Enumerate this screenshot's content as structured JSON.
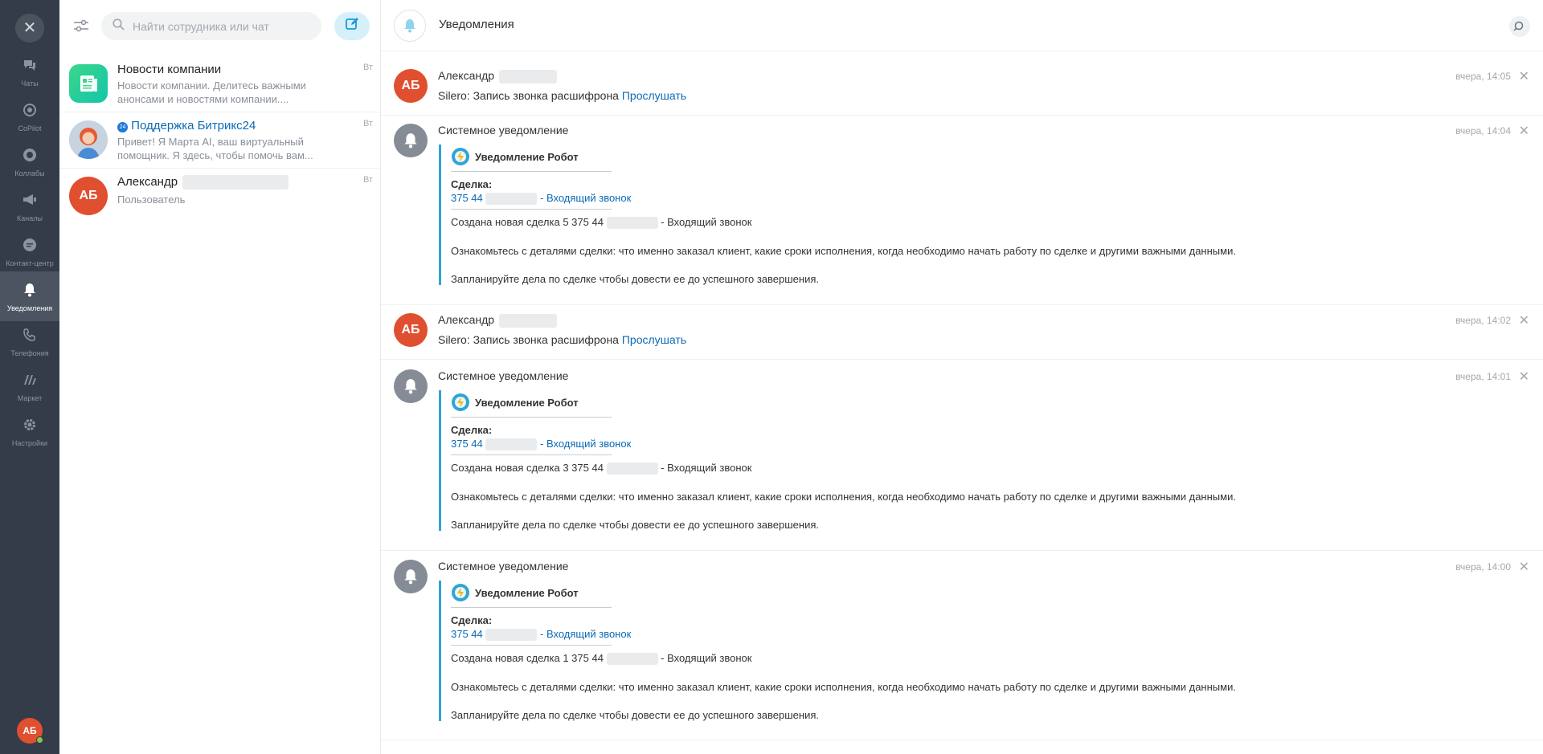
{
  "rail": {
    "items": [
      {
        "label": "Чаты",
        "icon": "chat-bubbles-icon"
      },
      {
        "label": "CoPilot",
        "icon": "copilot-icon"
      },
      {
        "label": "Коллабы",
        "icon": "collab-icon"
      },
      {
        "label": "Каналы",
        "icon": "megaphone-icon"
      },
      {
        "label": "Контакт-центр",
        "icon": "contact-center-icon"
      },
      {
        "label": "Уведомления",
        "icon": "bell-icon"
      },
      {
        "label": "Телефония",
        "icon": "phone-icon"
      },
      {
        "label": "Маркет",
        "icon": "market-icon"
      },
      {
        "label": "Настройки",
        "icon": "gear-icon"
      }
    ],
    "active": "Уведомления",
    "user_initials": "АБ"
  },
  "search": {
    "placeholder": "Найти сотрудника или чат"
  },
  "chats": [
    {
      "title": "Новости компании",
      "date": "Вт",
      "preview": "Новости компании. Делитесь важными анонсами и новостями компании...."
    },
    {
      "title": "Поддержка Битрикс24",
      "date": "Вт",
      "preview": "Привет! Я Марта AI, ваш виртуальный помощник. Я здесь, чтобы помочь вам..."
    },
    {
      "title": "Александр",
      "date": "Вт",
      "preview": "Пользователь",
      "initials": "АБ"
    }
  ],
  "header": {
    "title": "Уведомления"
  },
  "notifications": [
    {
      "type": "user",
      "initials": "АБ",
      "author": "Александр",
      "time": "вчера, 14:05",
      "text": "Silero: Запись звонка расшифрона",
      "link": "Прослушать"
    },
    {
      "type": "system",
      "author": "Системное уведомление",
      "time": "вчера, 14:04",
      "robot": "Уведомление Робот",
      "deal_label": "Сделка:",
      "deal_prefix": "375 44",
      "deal_suffix": "- Входящий звонок",
      "created_prefix": "Создана новая сделка 5 375 44",
      "created_suffix": "- Входящий звонок",
      "details": "Ознакомьтесь с деталями сделки: что именно заказал клиент, какие сроки исполнения, когда необходимо начать работу по сделке и другими важными данными.",
      "plan": "Запланируйте дела по сделке чтобы довести ее до успешного завершения."
    },
    {
      "type": "user",
      "initials": "АБ",
      "author": "Александр",
      "time": "вчера, 14:02",
      "text": "Silero: Запись звонка расшифрона",
      "link": "Прослушать"
    },
    {
      "type": "system",
      "author": "Системное уведомление",
      "time": "вчера, 14:01",
      "robot": "Уведомление Робот",
      "deal_label": "Сделка:",
      "deal_prefix": "375 44",
      "deal_suffix": "- Входящий звонок",
      "created_prefix": "Создана новая сделка 3 375 44",
      "created_suffix": "- Входящий звонок",
      "details": "Ознакомьтесь с деталями сделки: что именно заказал клиент, какие сроки исполнения, когда необходимо начать работу по сделке и другими важными данными.",
      "plan": "Запланируйте дела по сделке чтобы довести ее до успешного завершения."
    },
    {
      "type": "system",
      "author": "Системное уведомление",
      "time": "вчера, 14:00",
      "robot": "Уведомление Робот",
      "deal_label": "Сделка:",
      "deal_prefix": "375 44",
      "deal_suffix": "- Входящий звонок",
      "created_prefix": "Создана новая сделка 1 375 44",
      "created_suffix": "- Входящий звонок",
      "details": "Ознакомьтесь с деталями сделки: что именно заказал клиент, какие сроки исполнения, когда необходимо начать работу по сделке и другими важными данными.",
      "plan": "Запланируйте дела по сделке чтобы довести ее до успешного завершения."
    }
  ],
  "colors": {
    "rail_bg": "#333c48",
    "accent_blue": "#2fa4d8",
    "link": "#0b6ab5",
    "avatar_red": "#e04f2f",
    "system_avatar": "#868c95"
  }
}
